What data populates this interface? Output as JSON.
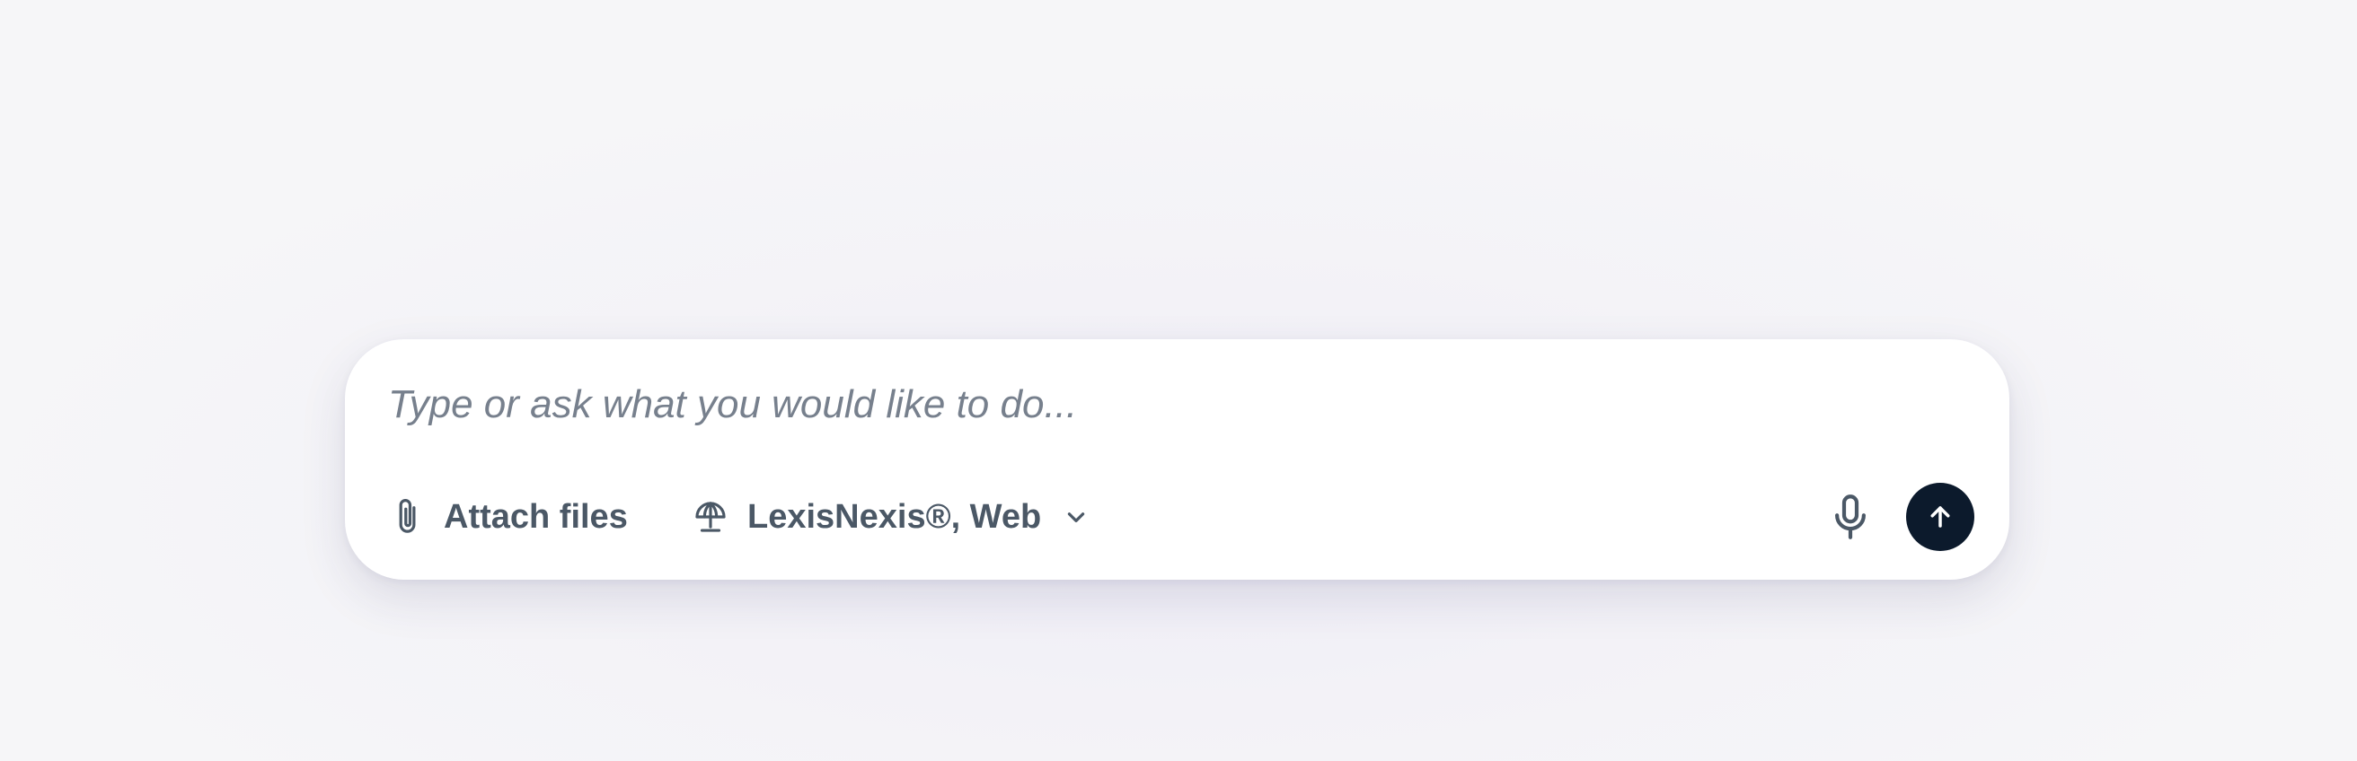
{
  "composer": {
    "placeholder": "Type or ask what you would like to do...",
    "value": ""
  },
  "toolbar": {
    "attach_label": "Attach files",
    "attach_icon": "paperclip-icon",
    "sources_label": "LexisNexis®, Web",
    "sources_icon": "umbrella-icon",
    "sources_chevron_icon": "chevron-down-icon",
    "mic_icon": "microphone-icon",
    "send_icon": "arrow-up-icon"
  },
  "colors": {
    "send_button_bg": "#0c1a2c",
    "toolbar_text": "#4b5866",
    "placeholder_text": "#77808d"
  }
}
